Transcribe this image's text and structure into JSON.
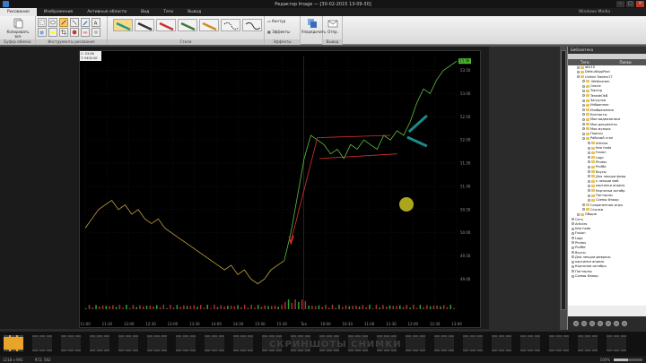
{
  "window": {
    "title": "Редактор Image — [30-02-2015 13-09-30]"
  },
  "menu": {
    "items": [
      "Рисование",
      "Изображение",
      "Активные области",
      "Вид",
      "Теги",
      "Вывод"
    ],
    "active": 0,
    "right_hint": "Windows Media"
  },
  "ribbon": {
    "copy_label": "Копировать все",
    "group_labels": [
      "Буфер обмена",
      "Инструменты рисования",
      "Стили",
      "Эффекты",
      "Вывод"
    ],
    "effects": [
      "Контур",
      "Эффекты"
    ],
    "arrange_label": "Упорядочить",
    "send_label": "Отпр."
  },
  "infobox": {
    "line1": "C: 53.06",
    "line2": "T: 5402.00"
  },
  "chart_data": {
    "type": "line",
    "x_ticks": [
      "11:00",
      "11:30",
      "12:00",
      "12:30",
      "13:00",
      "13:30",
      "14:00",
      "14:30",
      "15:00",
      "15:30",
      "Tue",
      "10:00",
      "10:30",
      "11:00",
      "11:30",
      "12:00",
      "12:30",
      "13:00"
    ],
    "y_ticks": [
      "53.50",
      "53.00",
      "52.50",
      "52.00",
      "51.50",
      "51.00",
      "50.50",
      "50.00",
      "49.50",
      "49.00"
    ],
    "ylim": [
      48.7,
      53.8
    ],
    "last_label": "53.06",
    "series": [
      {
        "values": [
          50.1,
          50.3,
          50.5,
          50.6,
          50.7,
          50.5,
          50.6,
          50.4,
          50.5,
          50.3,
          50.2,
          50.3,
          50.1,
          50.0,
          49.9,
          49.8,
          49.7,
          49.6,
          49.5,
          49.4,
          49.3,
          49.2,
          49.3,
          49.1,
          49.2,
          49.0,
          48.9,
          49.0,
          49.2,
          49.3,
          49.4,
          50.0,
          50.8,
          51.6,
          52.1,
          52.0,
          51.9,
          51.7,
          51.8,
          51.6,
          51.9,
          51.8,
          52.0,
          51.9,
          51.8,
          52.1,
          52.0,
          52.2,
          52.1,
          52.4,
          52.8,
          53.1,
          53.0,
          53.3,
          53.5,
          53.6,
          53.7
        ]
      }
    ],
    "annotations": [
      "flag-pattern",
      "pointer-arrows"
    ]
  },
  "filmstrip": {
    "watermark": "СКРИНШОТЫ СНИМКИ",
    "frame_count": 22,
    "selected": 0
  },
  "status": {
    "dims": "1218 x 941",
    "coord": "972, 562",
    "zoom": "100%"
  },
  "tree": {
    "title": "Библиотека",
    "columns": [
      "Теги",
      "Папки"
    ],
    "items": [
      {
        "label": "abc10",
        "d": 1,
        "f": true
      },
      {
        "label": "DefaultAppPool",
        "d": 1,
        "f": true
      },
      {
        "label": "United Traders77",
        "d": 1,
        "f": true
      },
      {
        "label": ".Webinarom",
        "d": 2,
        "f": true
      },
      {
        "label": "Oracle",
        "d": 2,
        "f": true
      },
      {
        "label": "Tracing",
        "d": 2,
        "f": true
      },
      {
        "label": "TeradeOkB",
        "d": 2,
        "f": true
      },
      {
        "label": "Загрузки",
        "d": 2,
        "f": true
      },
      {
        "label": "Избранное",
        "d": 2,
        "f": true
      },
      {
        "label": "Изображения",
        "d": 2,
        "f": true
      },
      {
        "label": "Контакты",
        "d": 2,
        "f": true
      },
      {
        "label": "Мои видеозаписи",
        "d": 2,
        "f": true
      },
      {
        "label": "Мои документы",
        "d": 2,
        "f": true
      },
      {
        "label": "Моя музыка",
        "d": 2,
        "f": true
      },
      {
        "label": "Поиски",
        "d": 2,
        "f": true
      },
      {
        "label": "Рабочий стол",
        "d": 2,
        "f": true
      },
      {
        "label": "Articles",
        "d": 3,
        "f": true
      },
      {
        "label": "foto hada",
        "d": 3,
        "f": true
      },
      {
        "label": "Fusion",
        "d": 3,
        "f": true
      },
      {
        "label": "Logo",
        "d": 3,
        "f": true
      },
      {
        "label": "Photos",
        "d": 3,
        "f": true
      },
      {
        "label": "ProfBe",
        "d": 3,
        "f": true
      },
      {
        "label": "Вкусы",
        "d": 3,
        "f": true
      },
      {
        "label": "Для лекции февр.",
        "d": 3,
        "f": true
      },
      {
        "label": "к лекции май",
        "d": 3,
        "f": true
      },
      {
        "label": "картинки апрель",
        "d": 3,
        "f": true
      },
      {
        "label": "Картинки октябр",
        "d": 3,
        "f": true
      },
      {
        "label": "Паттерны",
        "d": 3,
        "f": true
      },
      {
        "label": "Схемы Флоор",
        "d": 3,
        "f": true
      },
      {
        "label": "Сохраненные игры",
        "d": 2,
        "f": true
      },
      {
        "label": "Ссылки",
        "d": 2,
        "f": true
      },
      {
        "label": "Общие",
        "d": 1,
        "f": true
      },
      {
        "label": "Сеть",
        "d": 0,
        "f": false
      },
      {
        "label": "Articles",
        "d": 0,
        "f": false
      },
      {
        "label": "foto hada",
        "d": 0,
        "f": false
      },
      {
        "label": "Fusion",
        "d": 0,
        "f": false
      },
      {
        "label": "Logo",
        "d": 0,
        "f": false
      },
      {
        "label": "Photos",
        "d": 0,
        "f": false
      },
      {
        "label": "ProfBe",
        "d": 0,
        "f": false
      },
      {
        "label": "Вкусы",
        "d": 0,
        "f": false
      },
      {
        "label": "Для лекции февраль",
        "d": 0,
        "f": false
      },
      {
        "label": "картинки апрель",
        "d": 0,
        "f": false
      },
      {
        "label": "Картинки октябрь",
        "d": 0,
        "f": false
      },
      {
        "label": "Паттерны",
        "d": 0,
        "f": false
      },
      {
        "label": "Схемы Флоор",
        "d": 0,
        "f": false
      }
    ]
  }
}
